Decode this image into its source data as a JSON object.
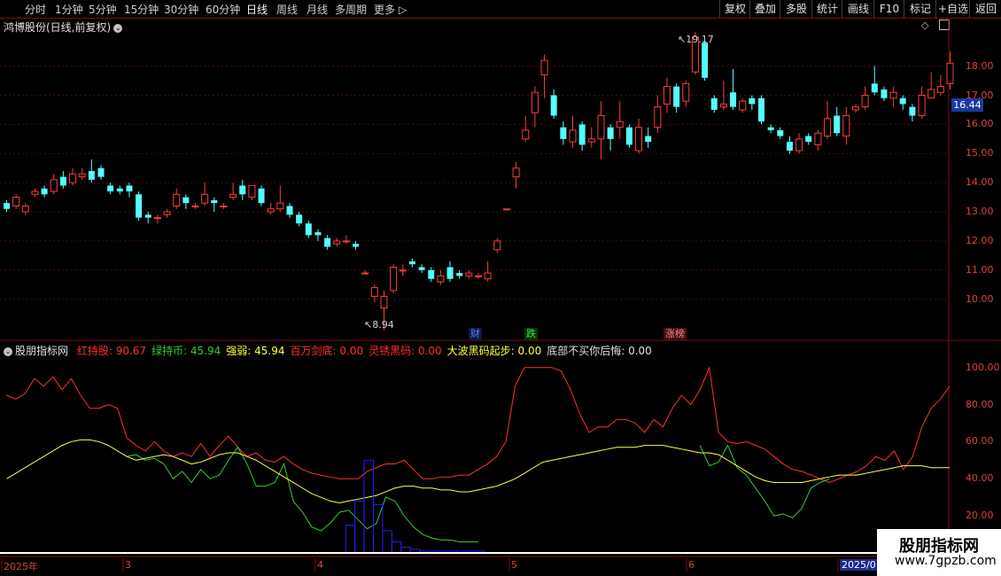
{
  "toolbar": {
    "periods": [
      "分时",
      "1分钟",
      "5分钟",
      "15分钟",
      "30分钟",
      "60分钟",
      "日线",
      "周线",
      "月线",
      "多周期",
      "更多"
    ],
    "active_period": "日线",
    "right_buttons": [
      "复权",
      "叠加",
      "多股",
      "统计",
      "画线",
      "F10",
      "标记",
      "+自选",
      "返回"
    ]
  },
  "main_panel": {
    "title": "鸿博股份(日线,前复权)",
    "price_axis": [
      "18.00",
      "17.00",
      "16.00",
      "15.00",
      "14.00",
      "13.00",
      "12.00",
      "11.00",
      "10.00"
    ],
    "current_price": "16.44",
    "high_label": "19.17",
    "low_label": "8.94",
    "markers": [
      {
        "text": "财",
        "color": "#3060ff"
      },
      {
        "text": "跌",
        "color": "#30c030"
      },
      {
        "text": "涨榜",
        "color": "#ff4040"
      }
    ]
  },
  "indicator_panel": {
    "name": "股朋指标网",
    "items": [
      {
        "label": "红持股: ",
        "value": "90.67",
        "color": "#ff3030"
      },
      {
        "label": "绿持币: ",
        "value": "45.94",
        "color": "#30d030"
      },
      {
        "label": "强弱: ",
        "value": "45.94",
        "color": "#ffff40"
      },
      {
        "label": "百万剑底: ",
        "value": "0.00",
        "color": "#ff3030"
      },
      {
        "label": "灵锈黑码: ",
        "value": "0.00",
        "color": "#ff3030"
      },
      {
        "label": "大波黑码起步: ",
        "value": "0.00",
        "color": "#ffff40"
      },
      {
        "label": "底部不买你后悔: ",
        "value": "0.00",
        "color": "#e0e0e0"
      }
    ],
    "axis": [
      "100.00",
      "80.00",
      "60.00",
      "40.00",
      "20.00"
    ]
  },
  "date_axis": [
    "2025年",
    "3",
    "4",
    "5",
    "6",
    "2025/0"
  ],
  "watermark": {
    "line1": "股朋指标网",
    "line2": "www.7gpzb.com"
  },
  "colors": {
    "up": "#ff3c3c",
    "down": "#54ffff",
    "ma": "#ffff40",
    "green": "#30d030",
    "blue": "#2020ff"
  },
  "candles": [
    [
      13.3,
      13.1,
      13.4,
      13.0
    ],
    [
      13.2,
      13.5,
      13.6,
      13.1
    ],
    [
      13.0,
      13.2,
      13.3,
      12.9
    ],
    [
      13.6,
      13.7,
      13.8,
      13.5
    ],
    [
      13.8,
      13.6,
      13.9,
      13.5
    ],
    [
      13.7,
      14.1,
      14.3,
      13.6
    ],
    [
      14.2,
      13.9,
      14.4,
      13.8
    ],
    [
      14.0,
      14.3,
      14.5,
      13.9
    ],
    [
      14.2,
      14.3,
      14.5,
      14.1
    ],
    [
      14.4,
      14.1,
      14.8,
      14.0
    ],
    [
      14.5,
      14.2,
      14.6,
      14.1
    ],
    [
      13.9,
      13.7,
      14.0,
      13.6
    ],
    [
      13.8,
      13.7,
      13.9,
      13.6
    ],
    [
      13.9,
      13.7,
      14.0,
      13.5
    ],
    [
      13.6,
      12.8,
      13.7,
      12.7
    ],
    [
      12.9,
      12.8,
      13.0,
      12.6
    ],
    [
      12.8,
      12.8,
      12.9,
      12.6
    ],
    [
      12.9,
      13.0,
      13.1,
      12.8
    ],
    [
      13.2,
      13.6,
      13.8,
      13.1
    ],
    [
      13.5,
      13.3,
      13.6,
      13.1
    ],
    [
      13.2,
      13.2,
      13.3,
      13.1
    ],
    [
      13.3,
      13.6,
      14.0,
      13.2
    ],
    [
      13.4,
      13.3,
      13.5,
      13.0
    ],
    [
      13.2,
      13.2,
      13.3,
      13.1
    ],
    [
      13.5,
      13.6,
      14.0,
      13.4
    ],
    [
      13.9,
      13.6,
      14.1,
      13.4
    ],
    [
      13.5,
      13.9,
      13.9,
      13.4
    ],
    [
      13.8,
      13.3,
      13.9,
      13.2
    ],
    [
      13.0,
      13.1,
      13.3,
      12.9
    ],
    [
      13.1,
      13.3,
      13.9,
      13.0
    ],
    [
      13.2,
      12.9,
      13.3,
      12.8
    ],
    [
      12.9,
      12.6,
      13.0,
      12.5
    ],
    [
      12.6,
      12.2,
      12.7,
      12.1
    ],
    [
      12.3,
      12.2,
      12.4,
      12.0
    ],
    [
      12.1,
      11.8,
      12.2,
      11.7
    ],
    [
      11.9,
      12.0,
      12.1,
      11.8
    ],
    [
      12.0,
      12.0,
      12.2,
      11.9
    ],
    [
      11.9,
      11.8,
      12.0,
      11.7
    ],
    [
      10.9,
      10.9,
      11.0,
      10.9
    ],
    [
      10.1,
      10.4,
      10.5,
      9.9
    ],
    [
      9.7,
      10.1,
      10.3,
      8.94
    ],
    [
      10.3,
      11.1,
      11.2,
      10.2
    ],
    [
      11.0,
      11.0,
      11.2,
      10.8
    ],
    [
      11.3,
      11.2,
      11.4,
      11.1
    ],
    [
      11.1,
      11.0,
      11.2,
      10.9
    ],
    [
      11.0,
      10.7,
      11.1,
      10.6
    ],
    [
      10.6,
      10.8,
      11.0,
      10.5
    ],
    [
      11.1,
      10.7,
      11.3,
      10.6
    ],
    [
      10.9,
      10.8,
      11.0,
      10.7
    ],
    [
      10.8,
      10.9,
      11.0,
      10.7
    ],
    [
      10.8,
      10.8,
      10.9,
      10.7
    ],
    [
      10.7,
      10.9,
      11.3,
      10.6
    ],
    [
      11.7,
      12.0,
      12.1,
      11.6
    ],
    [
      13.1,
      13.1,
      13.1,
      13.1
    ],
    [
      14.2,
      14.5,
      14.7,
      13.8
    ],
    [
      15.5,
      15.8,
      16.3,
      15.4
    ],
    [
      16.4,
      17.1,
      17.3,
      15.9
    ],
    [
      17.7,
      18.2,
      18.4,
      16.9
    ],
    [
      17.0,
      16.3,
      17.2,
      16.2
    ],
    [
      15.9,
      15.5,
      16.1,
      15.3
    ],
    [
      15.4,
      15.8,
      16.3,
      15.2
    ],
    [
      16.0,
      15.3,
      16.1,
      15.1
    ],
    [
      15.4,
      15.5,
      15.9,
      15.2
    ],
    [
      15.5,
      16.3,
      16.8,
      14.8
    ],
    [
      15.9,
      15.5,
      16.0,
      15.1
    ],
    [
      15.9,
      16.1,
      16.8,
      15.5
    ],
    [
      15.9,
      15.3,
      16.0,
      15.2
    ],
    [
      15.1,
      15.9,
      16.2,
      15.0
    ],
    [
      15.6,
      15.4,
      15.9,
      15.2
    ],
    [
      15.9,
      16.6,
      17.0,
      15.7
    ],
    [
      16.7,
      17.3,
      17.6,
      16.4
    ],
    [
      17.3,
      16.6,
      17.4,
      16.4
    ],
    [
      16.8,
      17.4,
      17.5,
      16.6
    ],
    [
      17.8,
      19.0,
      19.17,
      17.7
    ],
    [
      18.8,
      17.6,
      18.9,
      17.5
    ],
    [
      16.9,
      16.5,
      17.0,
      16.4
    ],
    [
      16.6,
      16.7,
      17.5,
      16.5
    ],
    [
      17.1,
      16.6,
      17.9,
      16.5
    ],
    [
      16.5,
      16.8,
      16.9,
      16.4
    ],
    [
      16.9,
      16.7,
      17.0,
      16.5
    ],
    [
      16.9,
      16.1,
      17.0,
      16.0
    ],
    [
      15.9,
      15.8,
      16.0,
      15.7
    ],
    [
      15.8,
      15.6,
      15.9,
      15.5
    ],
    [
      15.4,
      15.1,
      15.6,
      15.0
    ],
    [
      15.1,
      15.5,
      15.7,
      15.0
    ],
    [
      15.6,
      15.4,
      15.7,
      15.3
    ],
    [
      15.3,
      15.7,
      15.8,
      15.1
    ],
    [
      15.6,
      16.2,
      16.8,
      15.5
    ],
    [
      16.3,
      15.7,
      16.6,
      15.6
    ],
    [
      15.6,
      16.3,
      16.6,
      15.3
    ],
    [
      16.5,
      16.6,
      16.7,
      16.4
    ],
    [
      16.6,
      17.0,
      17.3,
      16.5
    ],
    [
      17.4,
      17.1,
      18.0,
      17.0
    ],
    [
      17.2,
      16.9,
      17.3,
      16.8
    ],
    [
      16.9,
      17.1,
      17.3,
      16.6
    ],
    [
      16.9,
      16.7,
      17.0,
      16.5
    ],
    [
      16.6,
      16.3,
      16.7,
      16.1
    ],
    [
      16.3,
      17.0,
      17.3,
      16.2
    ],
    [
      16.9,
      17.2,
      17.8,
      16.9
    ],
    [
      17.1,
      17.3,
      17.7,
      17.0
    ],
    [
      17.4,
      18.1,
      18.5,
      17.2
    ]
  ],
  "red_line": [
    85,
    83,
    86,
    94,
    90,
    95,
    88,
    94,
    85,
    78,
    78,
    80,
    78,
    62,
    58,
    55,
    60,
    55,
    52,
    54,
    52,
    59,
    52,
    58,
    63,
    57,
    52,
    54,
    50,
    49,
    52,
    48,
    45,
    43,
    42,
    41,
    40,
    40,
    40,
    44,
    46,
    48,
    48,
    50,
    45,
    40,
    40,
    41,
    41,
    42,
    42,
    45,
    48,
    52,
    60,
    90,
    100,
    100,
    100,
    100,
    98,
    88,
    75,
    65,
    68,
    68,
    72,
    72,
    70,
    65,
    72,
    68,
    78,
    85,
    80,
    88,
    100,
    65,
    60,
    59,
    60,
    58,
    56,
    52,
    48,
    45,
    44,
    42,
    40,
    38,
    40,
    42,
    44,
    47,
    52,
    50,
    55,
    45,
    52,
    68,
    78,
    83,
    90
  ],
  "green_line": [
    null,
    null,
    null,
    null,
    null,
    null,
    null,
    null,
    null,
    null,
    null,
    null,
    null,
    52,
    53,
    50,
    51,
    48,
    40,
    44,
    38,
    45,
    40,
    42,
    50,
    57,
    48,
    36,
    36,
    38,
    48,
    28,
    22,
    14,
    12,
    16,
    22,
    23,
    18,
    13,
    16,
    30,
    28,
    20,
    14,
    10,
    8,
    7,
    7,
    6,
    6,
    6,
    null,
    null,
    null,
    null,
    null,
    null,
    null,
    null,
    null,
    null,
    null,
    null,
    null,
    null,
    null,
    null,
    null,
    null,
    null,
    null,
    null,
    null,
    null,
    58,
    47,
    49,
    58,
    46,
    42,
    35,
    28,
    20,
    21,
    19,
    24,
    35,
    38,
    40,
    null,
    null,
    null,
    null,
    null,
    null,
    null,
    null,
    null,
    null,
    null,
    null
  ],
  "ma_line": [
    40,
    43,
    46,
    49,
    52,
    55,
    58,
    60,
    61,
    61,
    60,
    58,
    55,
    52,
    50,
    51,
    52,
    53,
    52,
    50,
    48,
    49,
    51,
    53,
    54,
    54,
    52,
    50,
    47,
    44,
    41,
    38,
    35,
    32,
    30,
    28,
    27,
    28,
    29,
    30,
    31,
    33,
    35,
    36,
    36,
    35,
    35,
    34,
    34,
    33,
    33,
    34,
    35,
    36,
    38,
    40,
    43,
    46,
    49,
    50,
    51,
    52,
    53,
    54,
    55,
    56,
    57,
    57,
    57,
    58,
    58,
    58,
    57,
    56,
    55,
    54,
    54,
    53,
    50,
    47,
    44,
    41,
    39,
    38,
    38,
    38,
    38,
    39,
    40,
    41,
    42,
    42,
    42,
    43,
    44,
    45,
    46,
    47,
    47,
    47,
    46,
    46,
    46
  ],
  "blue_bars": [
    null,
    null,
    null,
    null,
    null,
    null,
    null,
    null,
    null,
    null,
    null,
    null,
    null,
    null,
    null,
    null,
    null,
    null,
    null,
    null,
    null,
    null,
    null,
    null,
    null,
    null,
    null,
    null,
    null,
    null,
    null,
    null,
    null,
    null,
    null,
    null,
    null,
    15,
    28,
    50,
    26,
    12,
    6,
    3,
    2,
    1,
    1,
    1,
    1,
    1,
    1,
    1
  ]
}
